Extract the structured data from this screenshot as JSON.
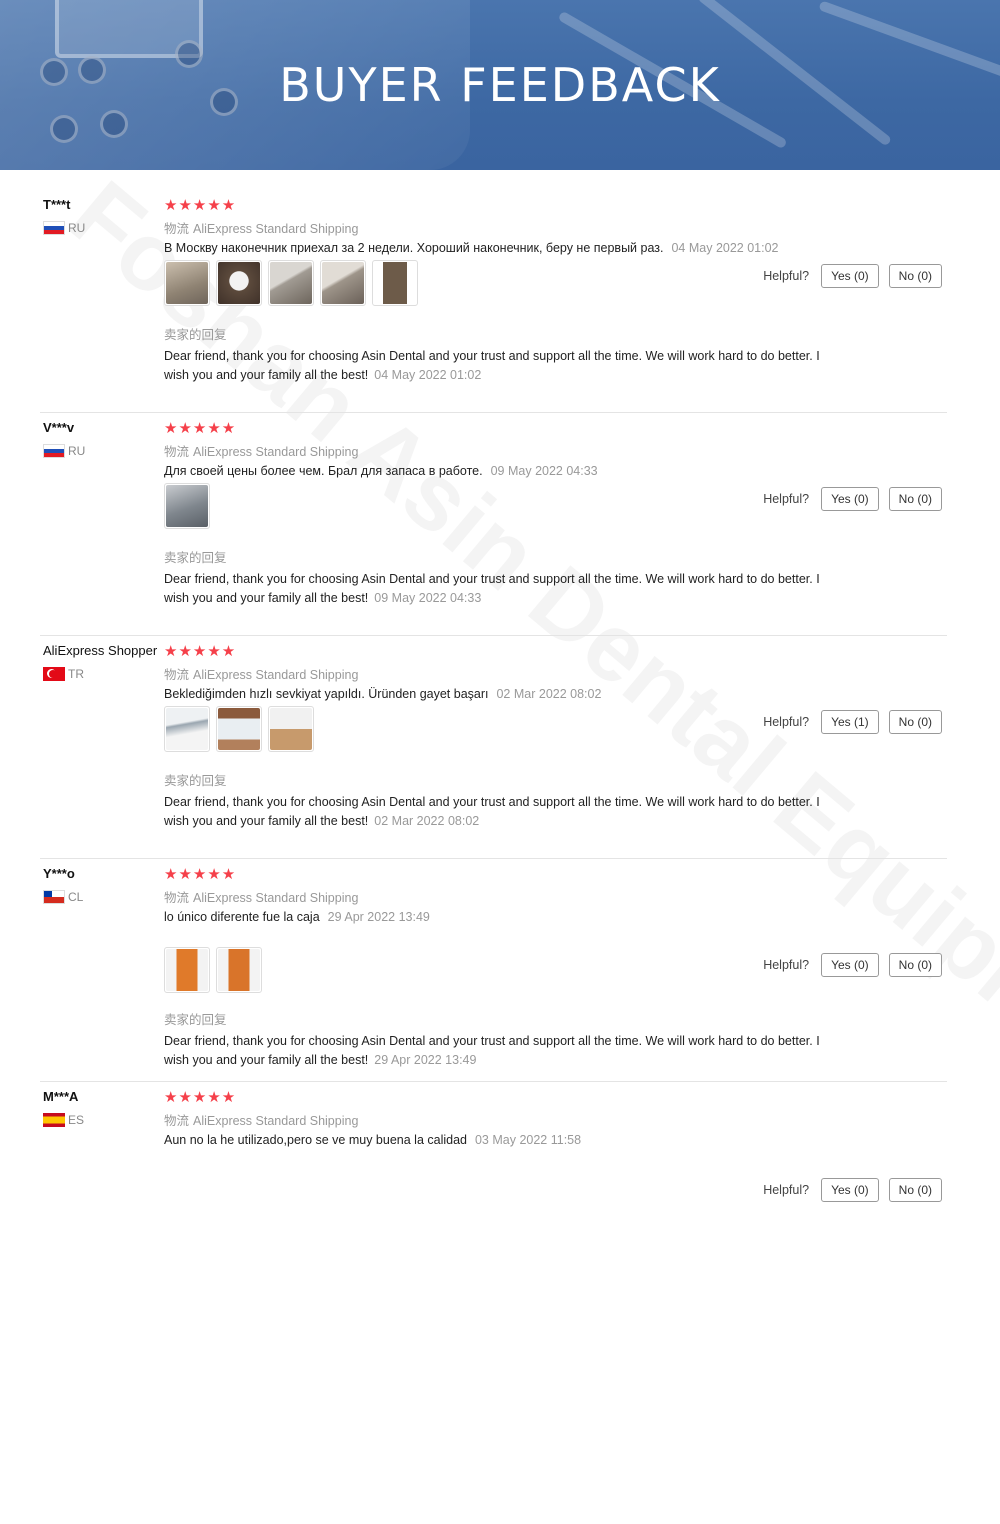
{
  "banner": {
    "title": "BUYER FEEDBACK"
  },
  "helpful_label": "Helpful?",
  "reviews": [
    {
      "name": "T***t",
      "country": "RU",
      "stars": "★★★★★",
      "logistics_prefix": "物流",
      "shipping": "AliExpress Standard Shipping",
      "text": "В Москву наконечник приехал за 2 недели. Хороший наконечник, беру не первый раз.",
      "date": "04 May 2022 01:02",
      "yes": "Yes (0)",
      "no": "No (0)",
      "reply_label": "卖家的回复",
      "reply": "Dear friend, thank you for choosing Asin Dental and your trust and support all the time. We will work hard to do better. I wish you and your family all the best!",
      "reply_date": "04 May 2022 01:02"
    },
    {
      "name": "V***v",
      "country": "RU",
      "stars": "★★★★★",
      "logistics_prefix": "物流",
      "shipping": "AliExpress Standard Shipping",
      "text": "Для своей цены более чем. Брал для запаса в работе.",
      "date": "09 May 2022 04:33",
      "yes": "Yes (0)",
      "no": "No (0)",
      "reply_label": "卖家的回复",
      "reply": "Dear friend, thank you for choosing Asin Dental and your trust and support all the time. We will work hard to do better. I wish you and your family all the best!",
      "reply_date": "09 May 2022 04:33"
    },
    {
      "name": "AliExpress Shopper",
      "country": "TR",
      "stars": "★★★★★",
      "logistics_prefix": "物流",
      "shipping": "AliExpress Standard Shipping",
      "text": "Beklediğimden hızlı sevkiyat yapıldı. Üründen gayet başarı",
      "date": "02 Mar 2022 08:02",
      "yes": "Yes (1)",
      "no": "No (0)",
      "reply_label": "卖家的回复",
      "reply": "Dear friend, thank you for choosing Asin Dental and your trust and support all the time. We will work hard to do better. I wish you and your family all the best!",
      "reply_date": "02 Mar 2022 08:02"
    },
    {
      "name": "Y***o",
      "country": "CL",
      "stars": "★★★★★",
      "logistics_prefix": "物流",
      "shipping": "AliExpress Standard Shipping",
      "text": "lo único diferente fue la caja",
      "date": "29 Apr 2022 13:49",
      "yes": "Yes (0)",
      "no": "No (0)",
      "reply_label": "卖家的回复",
      "reply": "Dear friend, thank you for choosing Asin Dental and your trust and support all the time. We will work hard to do better. I wish you and your family all the best!",
      "reply_date": "29 Apr 2022 13:49"
    },
    {
      "name": "M***A",
      "country": "ES",
      "stars": "★★★★★",
      "logistics_prefix": "物流",
      "shipping": "AliExpress Standard Shipping",
      "text": "Aun no la he utilizado,pero se ve muy buena la calidad",
      "date": "03 May 2022 11:58",
      "yes": "Yes (0)",
      "no": "No (0)"
    }
  ],
  "watermark": {
    "text": "Foshan Asin Dental Equipment Co., Limited"
  },
  "colors": {
    "banner": "#3d68a3",
    "stars": "#f5404a",
    "muted": "#999999",
    "divider": "#e4e4e4"
  }
}
